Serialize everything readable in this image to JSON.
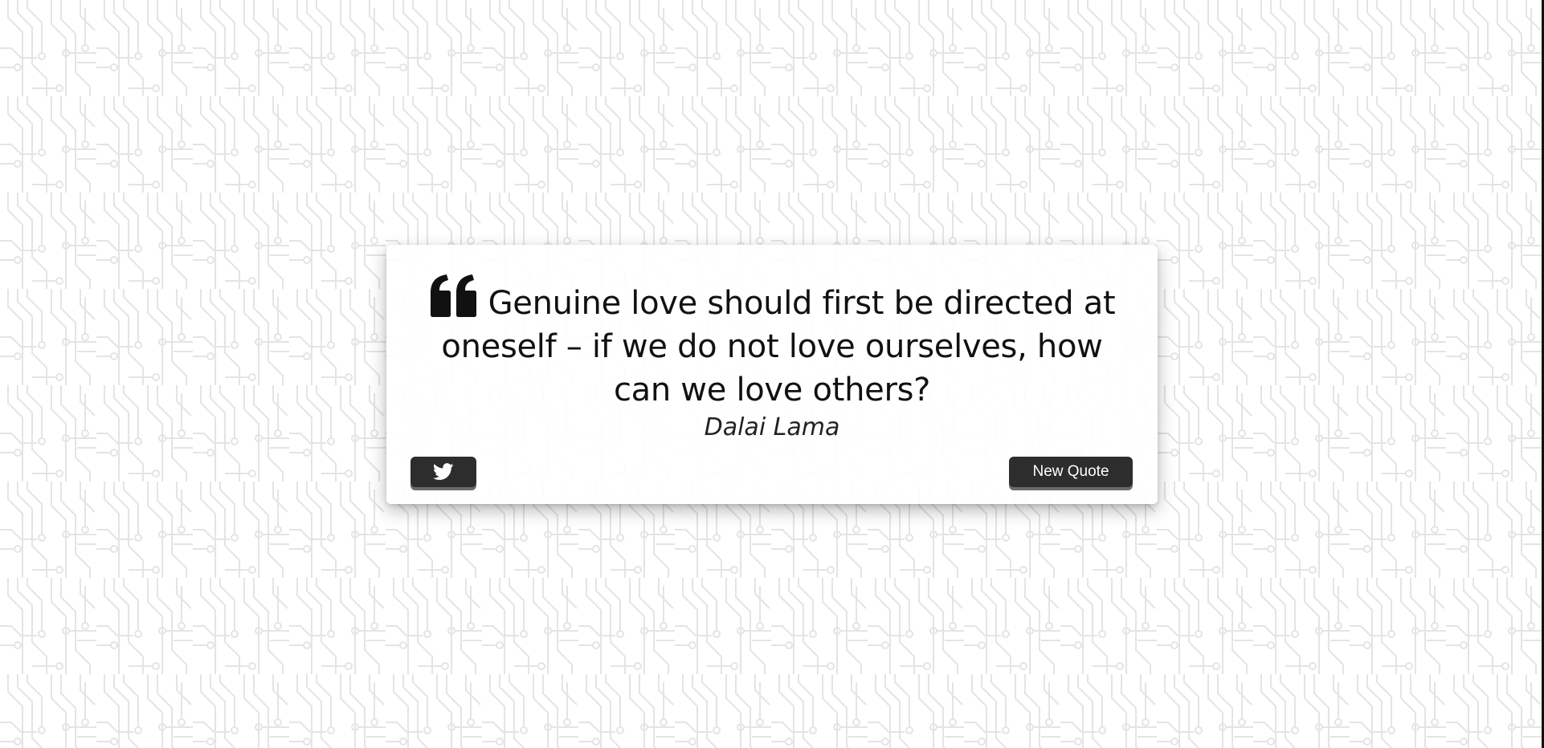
{
  "quote": {
    "text": "Genuine love should first be directed at oneself – if we do not love ourselves, how can we love others?",
    "author": "Dalai Lama",
    "icon": "quote-left-icon"
  },
  "actions": {
    "tweet_icon": "twitter-icon",
    "new_quote_label": "New Quote"
  },
  "colors": {
    "background": "#ffffff",
    "pattern": "#e6e6e6",
    "card": "#ffffff",
    "button": "#2d2d2d",
    "button_text": "#ffffff",
    "text": "#111111"
  }
}
